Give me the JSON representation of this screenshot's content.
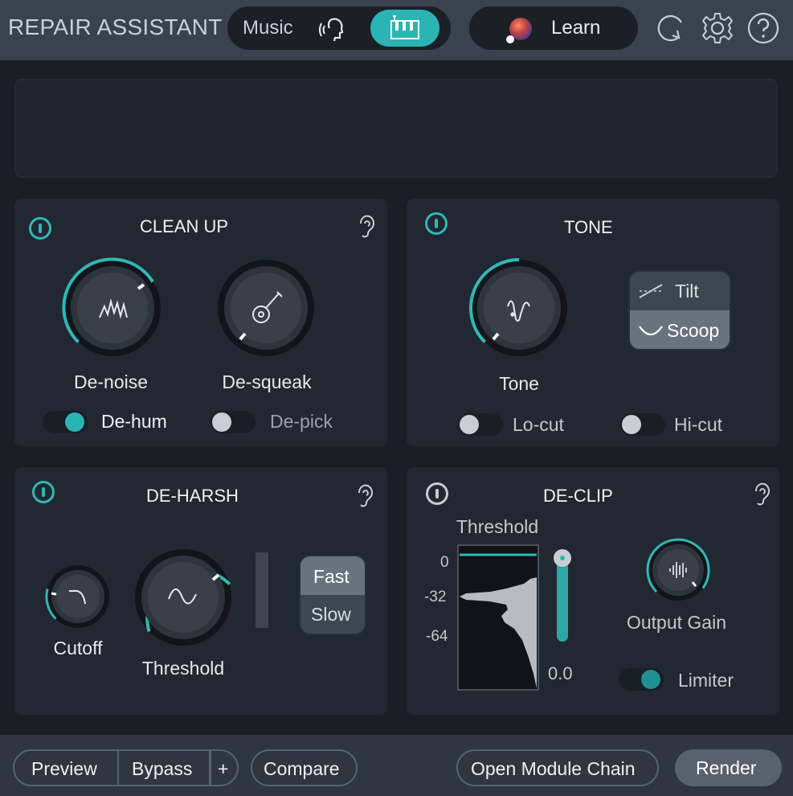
{
  "header": {
    "title": "REPAIR ASSISTANT",
    "mode_music_label": "Music",
    "learn_label": "Learn"
  },
  "clean_up": {
    "title": "CLEAN UP",
    "knobs": [
      {
        "label": "De-noise",
        "level": 0.72
      },
      {
        "label": "De-squeak",
        "level": 0.0
      }
    ],
    "toggles": [
      {
        "label": "De-hum",
        "on": true
      },
      {
        "label": "De-pick",
        "on": false
      }
    ]
  },
  "tone": {
    "title": "TONE",
    "knob": {
      "label": "Tone",
      "level": 0.48
    },
    "modes": [
      "Tilt",
      "Scoop"
    ],
    "selected_mode": "Scoop",
    "toggles": [
      {
        "label": "Lo-cut",
        "on": false
      },
      {
        "label": "Hi-cut",
        "on": false
      }
    ]
  },
  "de_harsh": {
    "title": "DE-HARSH",
    "cutoff": {
      "label": "Cutoff",
      "level": 0.1
    },
    "threshold": {
      "label": "Threshold",
      "level": 0.66
    },
    "speed_options": [
      "Fast",
      "Slow"
    ],
    "selected_speed": "Fast"
  },
  "de_clip": {
    "title": "DE-CLIP",
    "threshold_label": "Threshold",
    "db_ticks": [
      "0",
      "-32",
      "-64"
    ],
    "threshold_value": "0.0",
    "output_gain_label": "Output Gain",
    "output_gain_level": 0.9,
    "limiter_label": "Limiter",
    "limiter_on": true
  },
  "footer": {
    "preview_label": "Preview",
    "bypass_label": "Bypass",
    "plus_label": "+",
    "compare_label": "Compare",
    "open_chain_label": "Open Module Chain",
    "render_label": "Render"
  },
  "colors": {
    "accent": "#2bb4b4",
    "background": "#1a1e25",
    "panel": "#222831"
  },
  "icons": [
    "voice-icon",
    "instrument-icon",
    "undo-icon",
    "gear-icon",
    "help-icon",
    "power-icon",
    "ear-icon",
    "noise-icon",
    "guitar-icon",
    "tone-curve-icon",
    "tilt-icon",
    "scoop-icon",
    "lowpass-icon",
    "sine-icon",
    "waveform-icon"
  ]
}
